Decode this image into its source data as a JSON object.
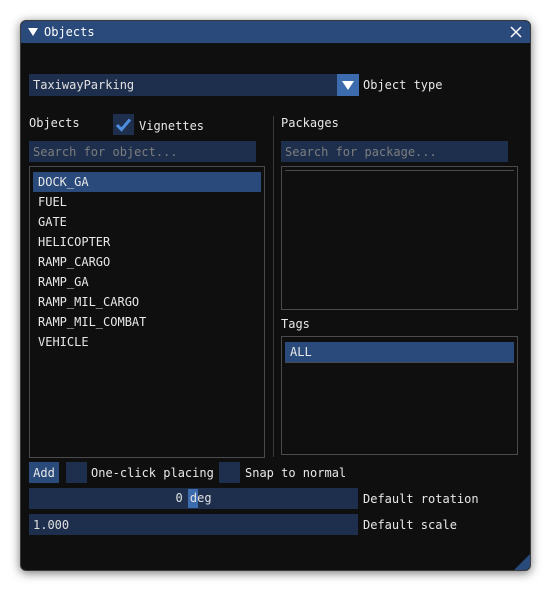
{
  "window": {
    "title": "Objects"
  },
  "object_type": {
    "value": "TaxiwayParking",
    "label": "Object type"
  },
  "objects": {
    "header": "Objects",
    "vignettes_label": "Vignettes",
    "vignettes_checked": true,
    "search_placeholder": "Search for object...",
    "items": [
      "DOCK_GA",
      "FUEL",
      "GATE",
      "HELICOPTER",
      "RAMP_CARGO",
      "RAMP_GA",
      "RAMP_MIL_CARGO",
      "RAMP_MIL_COMBAT",
      "VEHICLE"
    ],
    "selected_index": 0
  },
  "packages": {
    "header": "Packages",
    "search_placeholder": "Search for package...",
    "items": []
  },
  "tags": {
    "header": "Tags",
    "items": [
      "ALL"
    ],
    "selected_index": 0
  },
  "bottom": {
    "add_label": "Add",
    "one_click_label": "One-click placing",
    "snap_label": "Snap to normal",
    "rotation_value": "0 deg",
    "rotation_label": "Default rotation",
    "scale_value": "1.000",
    "scale_label": "Default scale"
  },
  "colors": {
    "accent": "#3d6cae",
    "title_bar": "#294a7a",
    "field_bg": "#1d2f4d",
    "window_bg": "#0f0f0f"
  }
}
